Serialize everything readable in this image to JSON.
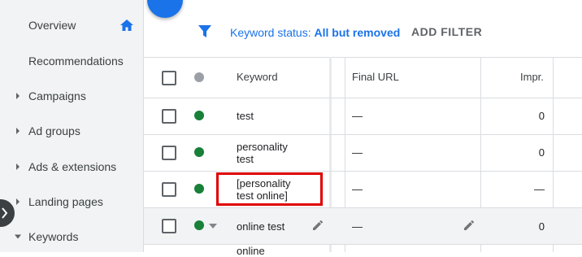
{
  "sidebar": {
    "items": [
      {
        "label": "Overview"
      },
      {
        "label": "Recommendations"
      },
      {
        "label": "Campaigns"
      },
      {
        "label": "Ad groups"
      },
      {
        "label": "Ads & extensions"
      },
      {
        "label": "Landing pages"
      },
      {
        "label": "Keywords"
      }
    ]
  },
  "toolbar": {
    "status_prefix": "Keyword status: ",
    "status_value": "All but removed",
    "add_filter": "ADD FILTER"
  },
  "table": {
    "headers": {
      "keyword": "Keyword",
      "final_url": "Final URL",
      "impr": "Impr."
    },
    "rows": [
      {
        "keyword": "test",
        "final_url": "—",
        "impr": "0",
        "status_color": "#188038"
      },
      {
        "keyword_line1": "personality",
        "keyword_line2": "test",
        "final_url": "—",
        "impr": "0",
        "status_color": "#188038"
      },
      {
        "keyword_line1": "[personality",
        "keyword_line2": "test online]",
        "final_url": "—",
        "impr": "—",
        "status_color": "#188038"
      },
      {
        "keyword": "online test",
        "final_url": "—",
        "impr": "0",
        "status_color": "#188038"
      },
      {
        "keyword": "online"
      }
    ]
  },
  "colors": {
    "accent": "#1a73e8",
    "status_green": "#188038",
    "highlight": "#e00000"
  }
}
